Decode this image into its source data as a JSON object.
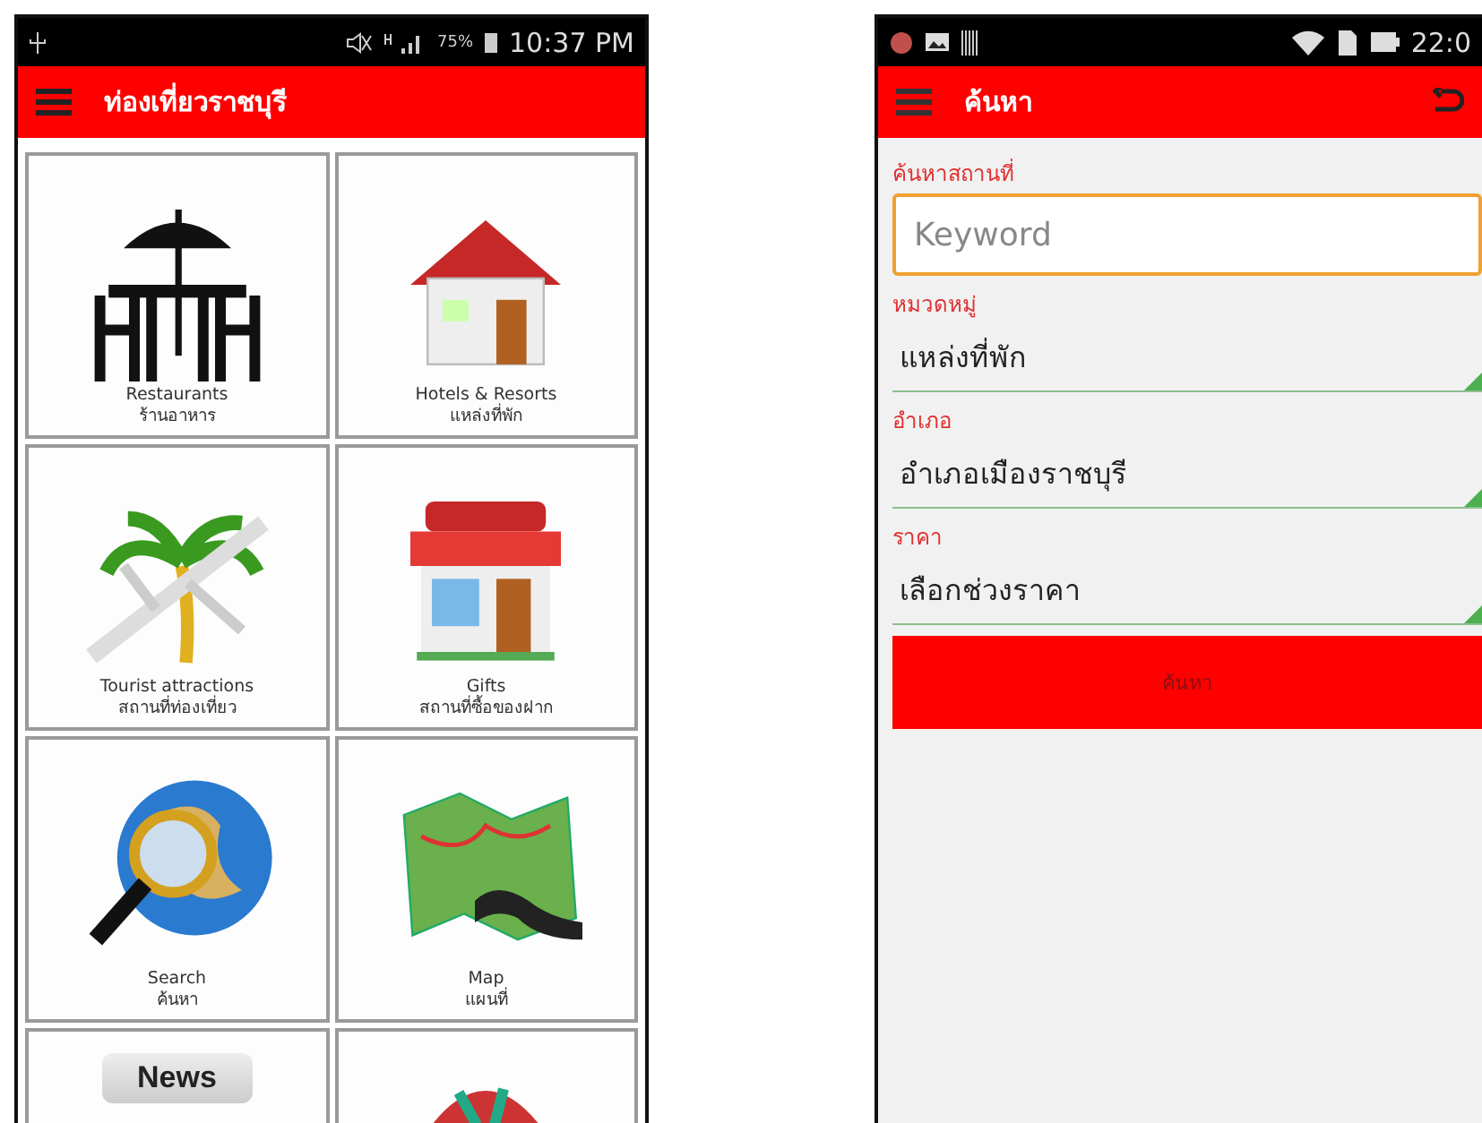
{
  "left_screen": {
    "status_bar": {
      "battery": "75%",
      "time": "10:37 PM"
    },
    "app_bar": {
      "title": "ท่องเที่ยวราชบุรี"
    },
    "tiles": [
      {
        "kind": "labeled",
        "label": "Restaurants",
        "label_th": "ร้านอาหาร"
      },
      {
        "kind": "labeled",
        "label": "Hotels & Resorts",
        "label_th": "แหล่งที่พัก"
      },
      {
        "kind": "labeled",
        "label": "Tourist attractions",
        "label_th": "สถานที่ท่องเที่ยว"
      },
      {
        "kind": "labeled",
        "label": "Gifts",
        "label_th": "สถานที่ซื้อของฝาก"
      },
      {
        "kind": "labeled",
        "label": "Search",
        "label_th": "ค้นหา"
      },
      {
        "kind": "labeled",
        "label": "Map",
        "label_th": "แผนที่"
      },
      {
        "kind": "partial",
        "caption": "News"
      },
      {
        "kind": "partial"
      }
    ]
  },
  "right_screen": {
    "status_bar": {
      "time": "22:0"
    },
    "app_bar": {
      "title": "ค้นหา"
    },
    "form": {
      "keyword": {
        "label": "ค้นหาสถานที่",
        "placeholder": "Keyword"
      },
      "selects": [
        {
          "label": "หมวดหมู่",
          "value": "แหล่งที่พัก"
        },
        {
          "label": "อำเภอ",
          "value": "อำเภอเมืองราชบุรี"
        },
        {
          "label": "ราคา",
          "value": "เลือกช่วงราคา"
        }
      ],
      "submit": "ค้นหา"
    }
  }
}
